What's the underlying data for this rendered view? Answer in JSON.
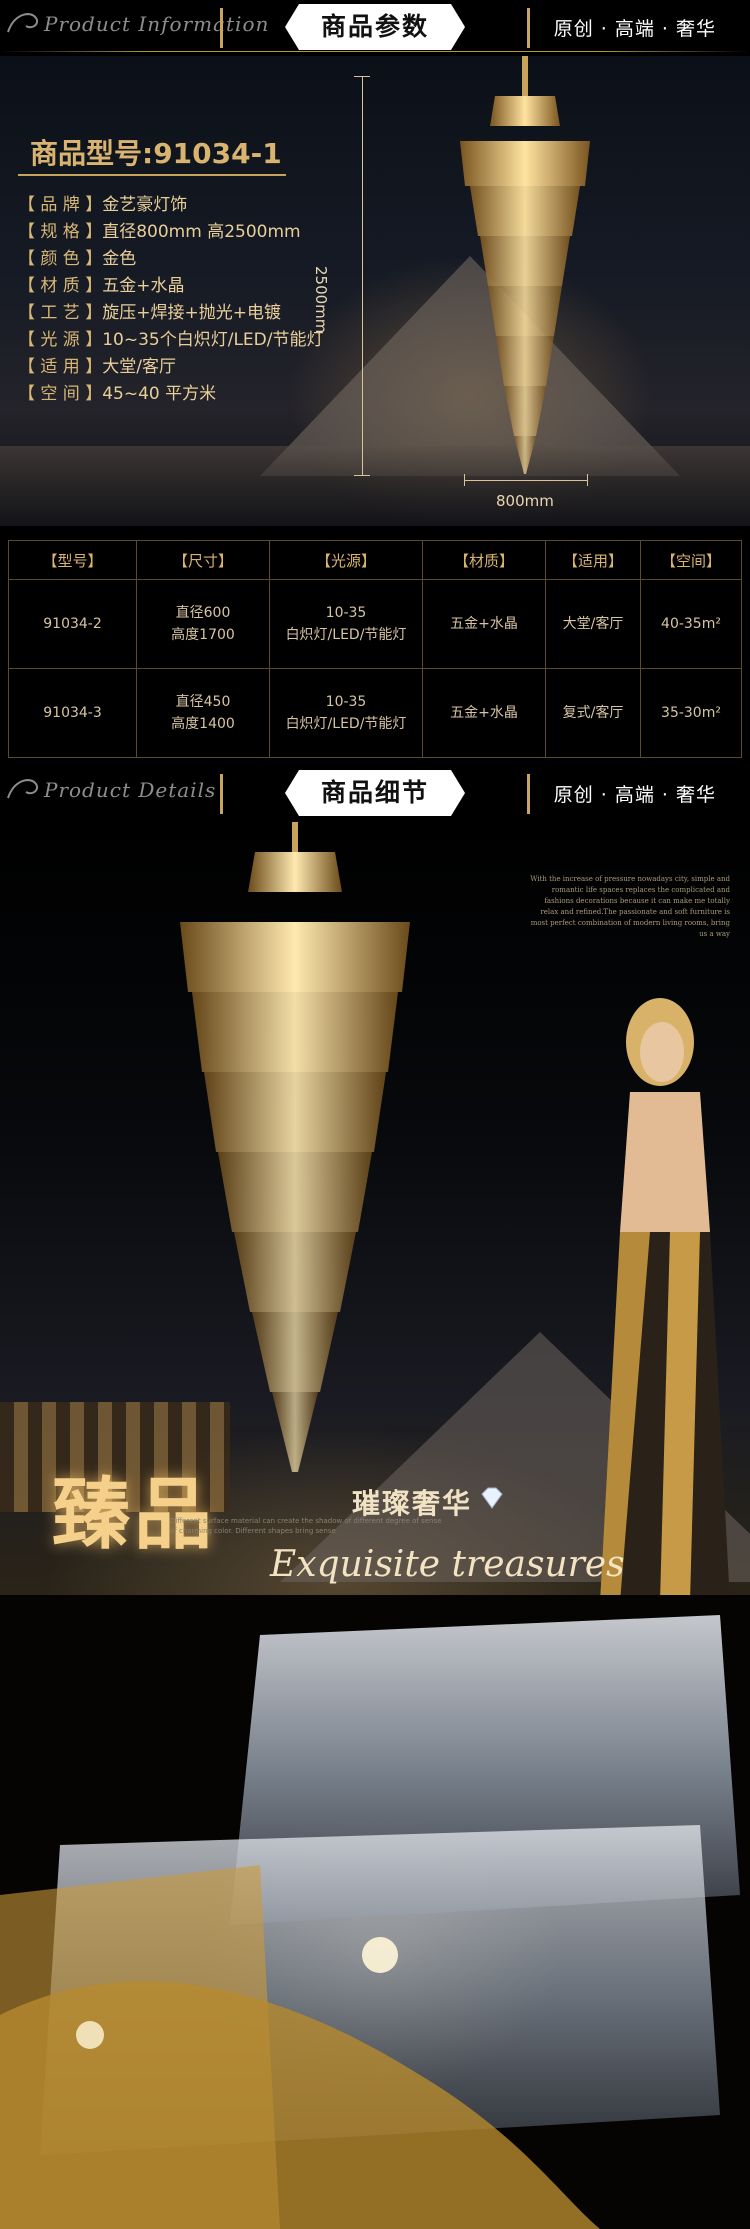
{
  "header1": {
    "left_title": "Product Information",
    "tag": "商品参数",
    "right_text": "原创 · 高端 · 奢华"
  },
  "product": {
    "model_label": "商品型号:91034-1",
    "specs": [
      {
        "key": "【 品 牌 】",
        "value": "金艺豪灯饰"
      },
      {
        "key": "【 规 格 】",
        "value": "直径800mm 高2500mm"
      },
      {
        "key": "【 颜 色 】",
        "value": "金色"
      },
      {
        "key": "【 材 质 】",
        "value": "五金+水晶"
      },
      {
        "key": "【 工 艺 】",
        "value": "旋压+焊接+抛光+电镀"
      },
      {
        "key": "【 光 源 】",
        "value": "10~35个白炽灯/LED/节能灯"
      },
      {
        "key": "【 适 用 】",
        "value": "大堂/客厅"
      },
      {
        "key": "【 空 间 】",
        "value": "45~40 平方米"
      }
    ],
    "height_label": "2500mm",
    "width_label": "800mm"
  },
  "variants": {
    "headers": [
      "【型号】",
      "【尺寸】",
      "【光源】",
      "【材质】",
      "【适用】",
      "【空间】"
    ],
    "rows": [
      {
        "model": "91034-2",
        "size1": "直径600",
        "size2": "高度1700",
        "light1": "10-35",
        "light2": "白炽灯/LED/节能灯",
        "material": "五金+水晶",
        "use": "大堂/客厅",
        "space": "40-35m²"
      },
      {
        "model": "91034-3",
        "size1": "直径450",
        "size2": "高度1400",
        "light1": "10-35",
        "light2": "白炽灯/LED/节能灯",
        "material": "五金+水晶",
        "use": "复式/客厅",
        "space": "35-30m²"
      }
    ]
  },
  "header2": {
    "left_title": "Product Details",
    "tag": "商品细节",
    "right_text": "原创 · 高端 · 奢华"
  },
  "detail": {
    "paragraph": "With the increase of pressure nowadays city, simple and romantic life spaces replaces the complicated and fashions decorations because it can make me totally relax and refined.The passionate and soft furniture is most perfect combination of modern living rooms, bring us a way",
    "big_title": "臻品",
    "subtitle_cn": "璀璨奢华",
    "small_en": "Different surface material can create the shadow of different degree of sense of charming color. Different shapes bring sense",
    "subtitle_en": "Exquisite treasures"
  },
  "colors": {
    "gold": "#c8a45a",
    "bg": "#000000"
  }
}
